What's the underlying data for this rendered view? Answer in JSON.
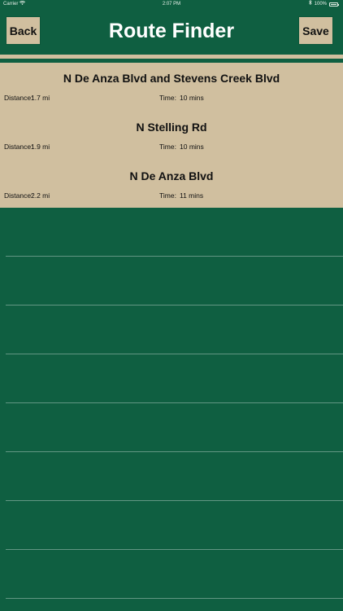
{
  "status_bar": {
    "carrier": "Carrier",
    "time": "2:07 PM",
    "battery": "100%"
  },
  "header": {
    "back_label": "Back",
    "title": "Route Finder",
    "save_label": "Save"
  },
  "routes": [
    {
      "name": "N De Anza Blvd and Stevens Creek Blvd",
      "distance_label": "Distance:",
      "distance": "1.7 mi",
      "time_label": "Time:",
      "time": "10 mins"
    },
    {
      "name": "N Stelling Rd",
      "distance_label": "Distance:",
      "distance": "1.9 mi",
      "time_label": "Time:",
      "time": "10 mins"
    },
    {
      "name": "N De Anza Blvd",
      "distance_label": "Distance:",
      "distance": "2.2 mi",
      "time_label": "Time:",
      "time": "11 mins"
    }
  ],
  "colors": {
    "background": "#0f5f41",
    "panel": "#d0bf9f",
    "title_text": "#ffffff"
  }
}
